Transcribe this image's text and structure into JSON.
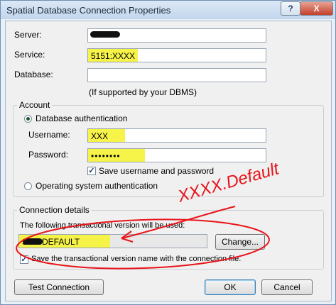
{
  "window": {
    "title": "Spatial Database Connection Properties",
    "help_label": "?",
    "close_label": "X"
  },
  "fields": {
    "server_label": "Server:",
    "server_value": "",
    "service_label": "Service:",
    "service_value": "5151:XXXX",
    "database_label": "Database:",
    "database_value": "",
    "dbms_note": "(If supported by your DBMS)"
  },
  "account": {
    "group_title": "Account",
    "db_auth_label": "Database authentication",
    "username_label": "Username:",
    "username_value": "XXX",
    "password_label": "Password:",
    "password_value": "••••••••",
    "save_label": "Save username and password",
    "os_auth_label": "Operating system authentication"
  },
  "connection": {
    "group_title": "Connection details",
    "version_note": "The following transactional version will be used:",
    "version_value": "SDE.DEFAULT",
    "change_label": "Change...",
    "save_version_label": "Save the transactional version name with the connection file."
  },
  "buttons": {
    "test_label": "Test Connection",
    "ok_label": "OK",
    "cancel_label": "Cancel"
  },
  "annotation": {
    "text": "XXXX.Default",
    "color": "#e8141a"
  },
  "colors": {
    "highlight": "#f5f23f",
    "annotation": "#e8141a"
  }
}
